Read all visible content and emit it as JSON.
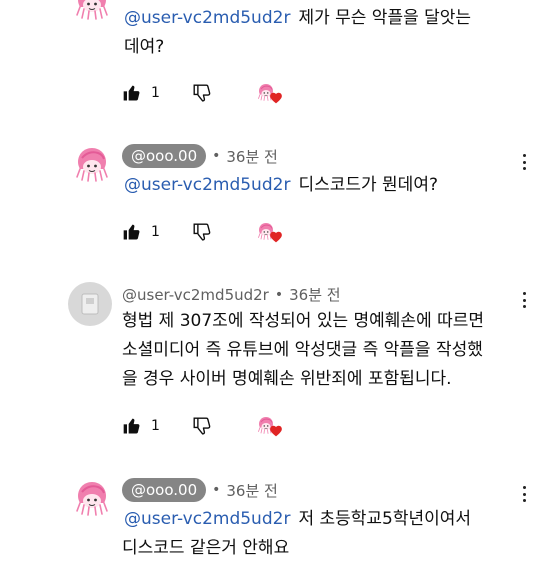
{
  "comments": [
    {
      "mention": "@user-vc2md5ud2r",
      "lines": [
        "제가 무슨 악플을 달앗는",
        "데여?"
      ],
      "likes": "1"
    },
    {
      "author": "@ooo.00",
      "time": "36분 전",
      "mention": "@user-vc2md5ud2r",
      "lines": [
        "디스코드가 뭔데여?"
      ],
      "likes": "1"
    },
    {
      "author": "@user-vc2md5ud2r",
      "time": "36분 전",
      "lines": [
        "형법 제 307조에 작성되어 있는 명예훼손에 따르면",
        "소셜미디어 즉 유튜브에 악성댓글 즉 악플을 작성했",
        "을 경우 사이버 명예훼손 위반죄에 포함됩니다."
      ],
      "likes": "1"
    },
    {
      "author": "@ooo.00",
      "time": "36분 전",
      "mention": "@user-vc2md5ud2r",
      "lines": [
        "저 초등학교5학년이여서",
        "디스코드 같은거 안해요"
      ]
    }
  ],
  "meta_separator": "•",
  "icons": {
    "like": "thumbs-up-filled-icon",
    "dislike": "thumbs-down-outline-icon",
    "creator_heart": "creator-heart-icon",
    "more": "more-vertical-icon",
    "avatar_pink": "pink-character-avatar",
    "avatar_gray": "gray-default-avatar"
  },
  "colors": {
    "mention": "#2a5db0",
    "author_chip": "#858585",
    "heart": "#e02424",
    "meta": "#606060"
  }
}
